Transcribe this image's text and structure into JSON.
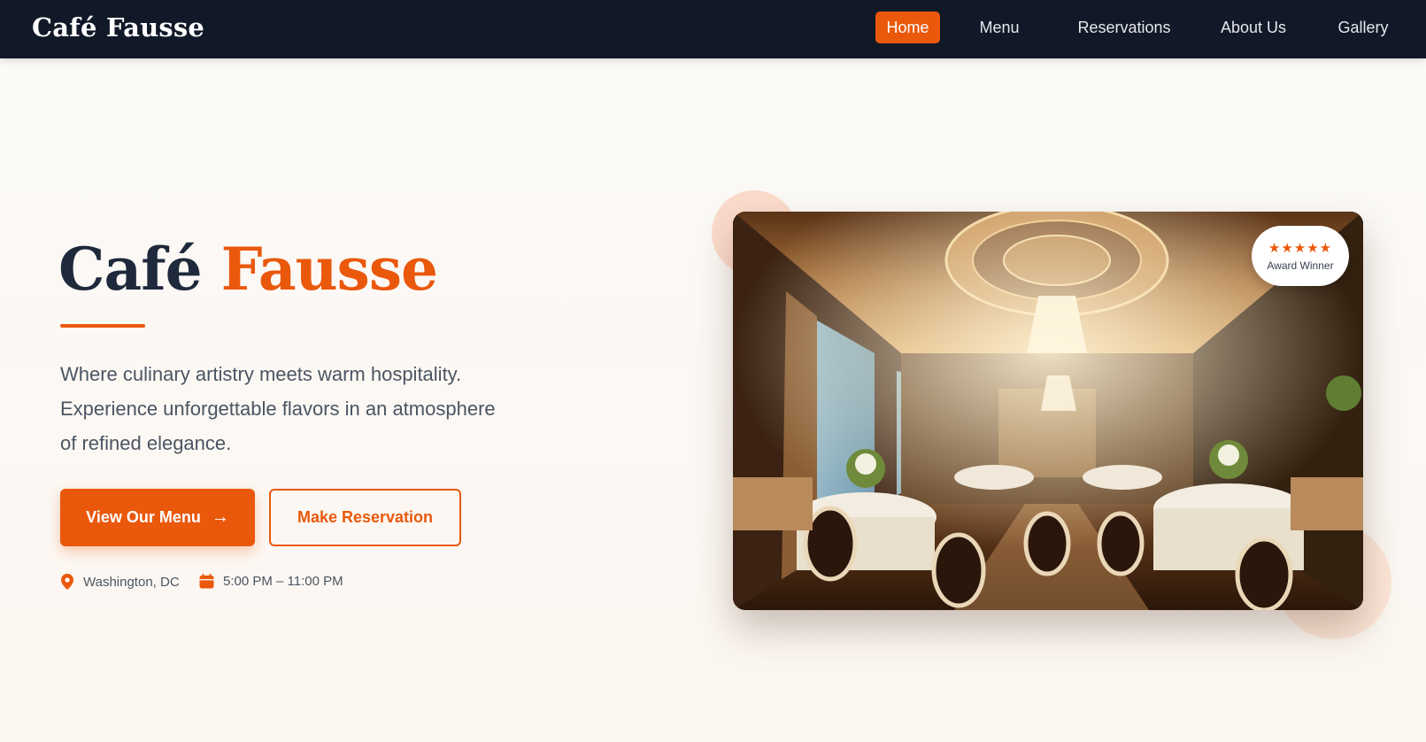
{
  "nav": {
    "brand": "Café Fausse",
    "links": [
      {
        "label": "Home",
        "active": true
      },
      {
        "label": "Menu",
        "active": false
      },
      {
        "label": "Reservations",
        "active": false
      },
      {
        "label": "About Us",
        "active": false
      },
      {
        "label": "Gallery",
        "active": false
      }
    ]
  },
  "hero": {
    "title_main": "Café",
    "title_accent": "Fausse",
    "description": "Where culinary artistry meets warm hospitality. Experience unforgettable flavors in an atmosphere of refined elegance.",
    "primary_button": "View Our Menu",
    "primary_button_icon": "arrow-right-icon",
    "secondary_button": "Make Reservation",
    "location": "Washington, DC",
    "location_icon": "map-pin-icon",
    "hours": "5:00 PM – 11:00 PM",
    "hours_icon": "calendar-icon"
  },
  "image": {
    "subject": "dining-room-photo",
    "badge": {
      "stars": "★★★★★",
      "rating": 5,
      "label": "Award Winner"
    }
  },
  "colors": {
    "accent": "#ea580c",
    "navbar": "#111827",
    "heading": "#1e293b",
    "body_text": "#4b5563"
  }
}
